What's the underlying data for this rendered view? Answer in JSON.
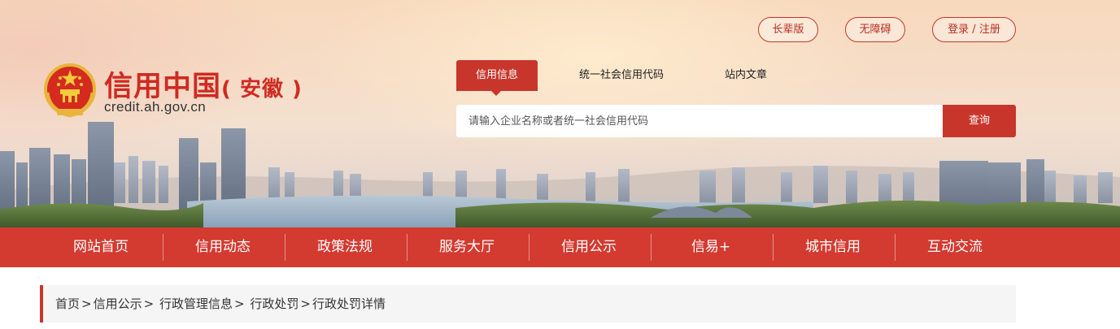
{
  "header": {
    "top_buttons": {
      "elder": "长辈版",
      "accessible": "无障碍",
      "login": "登录 / 注册"
    },
    "logo": {
      "title": "信用中国",
      "subtitle": "( 安徽 )",
      "url": "credit.ah.gov.cn"
    }
  },
  "search": {
    "tabs": [
      "信用信息",
      "统一社会信用代码",
      "站内文章"
    ],
    "active_tab": "信用信息",
    "placeholder": "请输入企业名称或者统一社会信用代码",
    "button_label": "查询"
  },
  "nav": {
    "items": [
      "网站首页",
      "信用动态",
      "政策法规",
      "服务大厅",
      "信用公示",
      "信易+",
      "城市信用",
      "互动交流"
    ]
  },
  "breadcrumb": {
    "items": [
      "首页",
      "信用公示",
      "行政管理信息",
      "行政处罚",
      "行政处罚详情"
    ],
    "separator": ">"
  },
  "colors": {
    "brand_red": "#d33a30",
    "accent_red": "#c8362b"
  }
}
